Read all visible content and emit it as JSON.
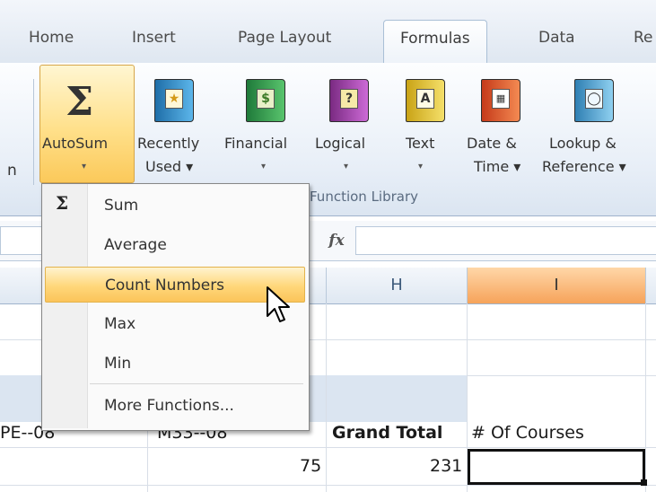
{
  "tabs": [
    {
      "label": "Home"
    },
    {
      "label": "Insert"
    },
    {
      "label": "Page Layout"
    },
    {
      "label": "Formulas",
      "active": true
    },
    {
      "label": "Data"
    },
    {
      "label": "Re"
    }
  ],
  "ribbon": {
    "left_partial_label": "n",
    "group_label": "Function Library",
    "buttons": [
      {
        "label": "AutoSum",
        "sub": "▾",
        "icon": "sigma-icon"
      },
      {
        "label": "Recently",
        "sub": "Used ▾",
        "icon": "recently-used-book-icon"
      },
      {
        "label": "Financial",
        "sub": "▾",
        "icon": "financial-book-icon"
      },
      {
        "label": "Logical",
        "sub": "▾",
        "icon": "logical-book-icon"
      },
      {
        "label": "Text",
        "sub": "▾",
        "icon": "text-book-icon"
      },
      {
        "label": "Date &",
        "sub": "Time ▾",
        "icon": "date-time-book-icon"
      },
      {
        "label": "Lookup &",
        "sub": "Reference ▾",
        "icon": "lookup-reference-book-icon"
      }
    ]
  },
  "formula_bar": {
    "fx": "fx"
  },
  "columns": {
    "h": "H",
    "i": "I"
  },
  "cells": {
    "partial_left": "PE--08",
    "partial_mid": "M33--08",
    "grand_total_header": "Grand Total",
    "courses_header": "# Of Courses",
    "value_75": "75",
    "value_231": "231"
  },
  "menu": {
    "items": [
      {
        "label": "Sum",
        "icon": "sigma-icon"
      },
      {
        "label": "Average"
      },
      {
        "label": "Count Numbers",
        "hover": true
      },
      {
        "label": "Max"
      },
      {
        "label": "Min"
      },
      {
        "label": "More Functions..."
      }
    ]
  },
  "colors": {
    "ribbon_highlight": "#ffd77a",
    "selected_column": "#f6a35a",
    "header_blue_fill": "#dbe5f1"
  }
}
